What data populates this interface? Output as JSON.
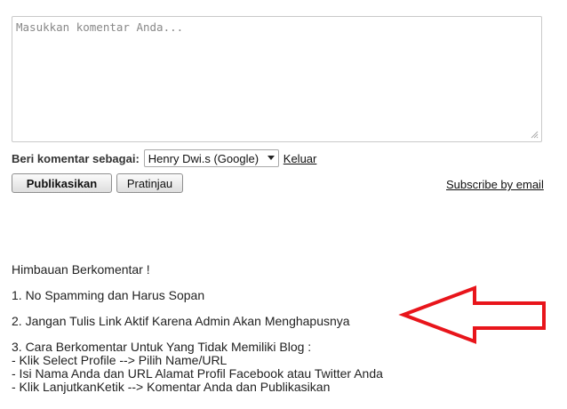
{
  "comment": {
    "placeholder": "Masukkan komentar Anda..."
  },
  "identity": {
    "label": "Beri komentar sebagai:",
    "selected": "Henry Dwi.s (Google)",
    "logout_label": "Keluar"
  },
  "actions": {
    "publish_label": "Publikasikan",
    "preview_label": "Pratinjau",
    "subscribe_label": "Subscribe by email"
  },
  "guidelines": {
    "heading": "Himbauan Berkomentar !",
    "rules": [
      "1. No Spamming dan Harus Sopan",
      "2. Jangan Tulis Link Aktif Karena Admin Akan Menghapusnya",
      "3. Cara Berkomentar Untuk Yang Tidak Memiliki Blog :"
    ],
    "steps": [
      "- Klik Select Profile --> Pilih Name/URL",
      "- Isi Nama Anda dan URL Alamat Profil Facebook atau Twitter Anda",
      "- Klik LanjutkanKetik --> Komentar Anda dan Publikasikan"
    ]
  },
  "annotation": {
    "arrow_color": "#e8151b",
    "icon": "left-arrow-icon"
  }
}
